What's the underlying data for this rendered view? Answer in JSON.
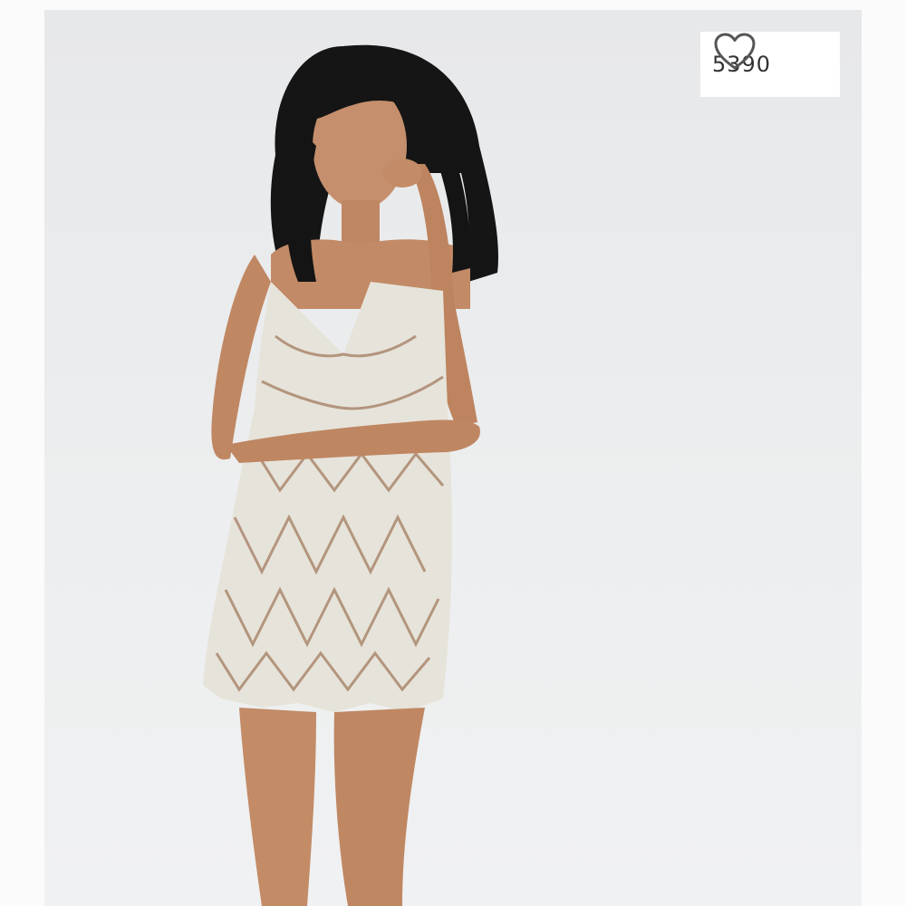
{
  "listing": {
    "photo_icon": "product-photo",
    "like_count": "5390",
    "like_icon": "heart-outline-icon",
    "colors": {
      "badge_bg": "#ffffff",
      "text": "#333333",
      "heart_stroke": "#555555"
    }
  }
}
